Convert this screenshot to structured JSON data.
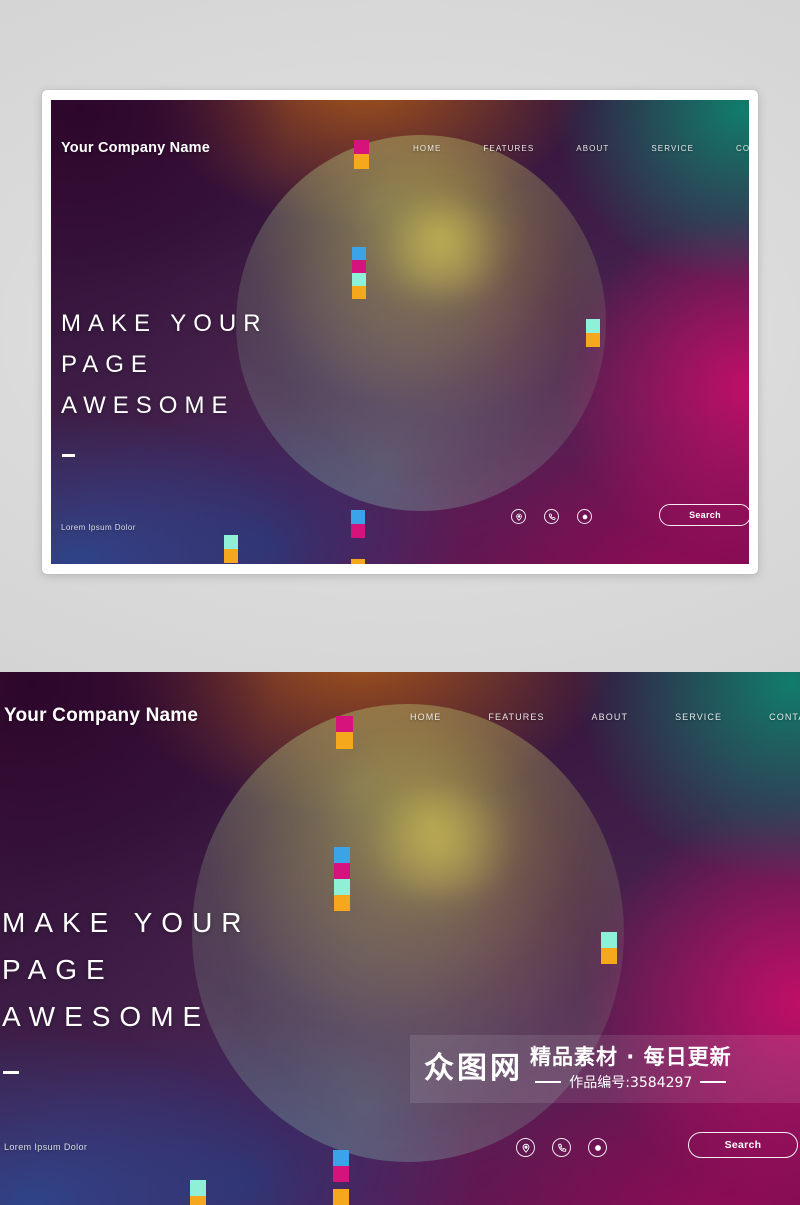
{
  "brand": {
    "name": "Your Company Name"
  },
  "nav": {
    "items": [
      {
        "label": "HOME"
      },
      {
        "label": "FEATURES"
      },
      {
        "label": "ABOUT"
      },
      {
        "label": "SERVICE"
      },
      {
        "label": "CONTACT US"
      }
    ]
  },
  "hero": {
    "headline_lines": [
      "MAKE YOUR",
      "PAGE",
      "AWESOME"
    ],
    "tagline": "Lorem Ipsum Dolor"
  },
  "actions": {
    "search_label": "Search",
    "icons": [
      {
        "name": "location-pin-icon"
      },
      {
        "name": "phone-icon"
      },
      {
        "name": "record-circle-icon"
      }
    ]
  },
  "watermark": {
    "logo_chars": [
      "众",
      "图",
      "网"
    ],
    "title": "精品素材 · 每日更新",
    "subtitle": "作品编号:3584297"
  },
  "colors": {
    "chip_blue": "#3ba3e8",
    "chip_magenta": "#d6137c",
    "chip_mint": "#8ff0d8",
    "chip_orange": "#f5a81c",
    "page_bg": "#dcdcdc",
    "card_bg": "#ffffff",
    "text_on_dark": "#ffffff"
  },
  "chips": {
    "top_pair": [
      "chip_magenta",
      "chip_orange"
    ],
    "upper_stack": [
      "chip_blue",
      "chip_magenta",
      "chip_mint",
      "chip_orange"
    ],
    "right_pair": [
      "chip_mint",
      "chip_orange"
    ],
    "bottom_pair": [
      "chip_blue",
      "chip_magenta"
    ],
    "bottom_left_pair": [
      "chip_mint",
      "chip_orange"
    ],
    "bottom_single": [
      "chip_orange"
    ]
  }
}
